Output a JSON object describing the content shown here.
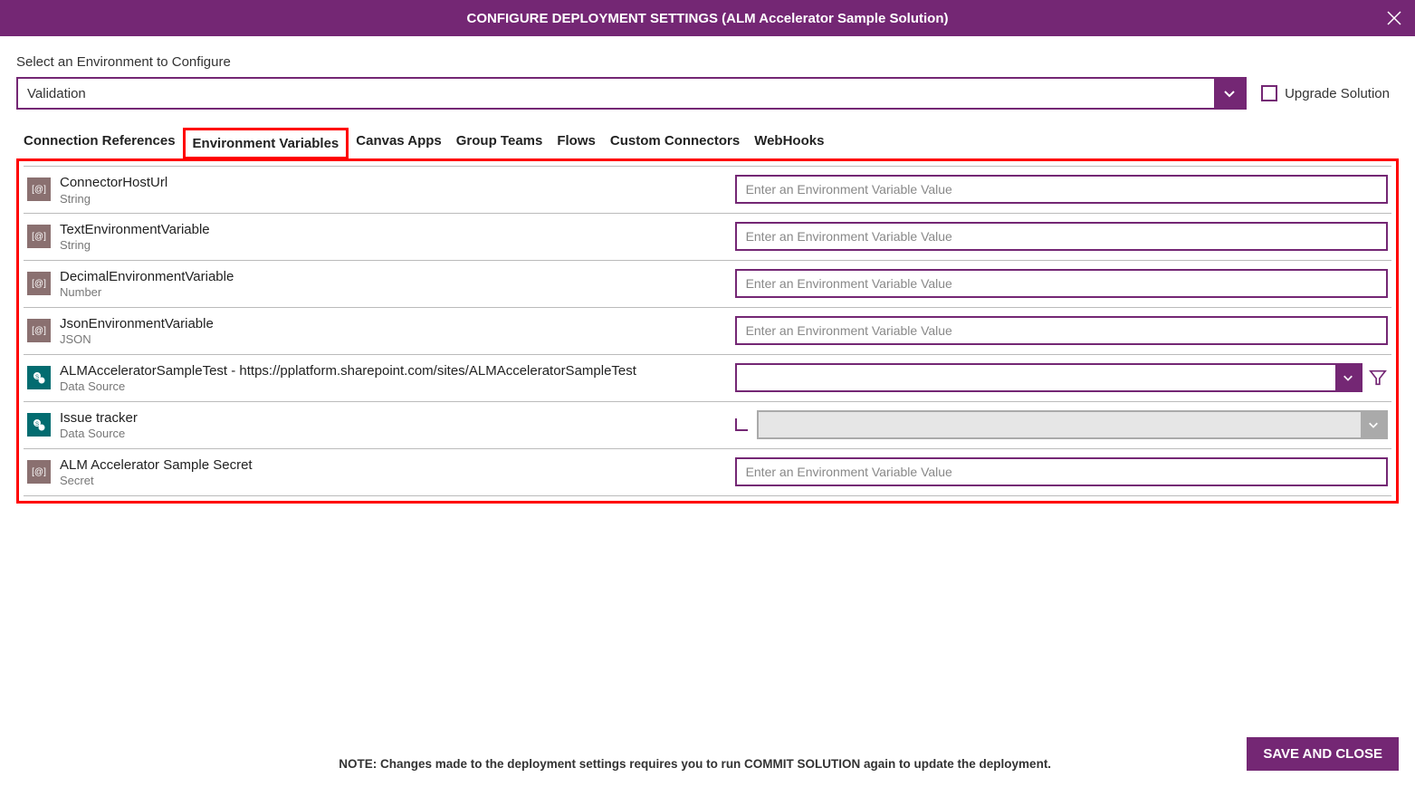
{
  "header": {
    "title": "CONFIGURE DEPLOYMENT SETTINGS (ALM Accelerator Sample Solution)"
  },
  "envSelect": {
    "label": "Select an Environment to Configure",
    "value": "Validation"
  },
  "upgradeCheckbox": {
    "label": "Upgrade Solution"
  },
  "tabs": [
    "Connection References",
    "Environment Variables",
    "Canvas Apps",
    "Group Teams",
    "Flows",
    "Custom Connectors",
    "WebHooks"
  ],
  "activeTabIndex": 1,
  "inputPlaceholder": "Enter an Environment Variable Value",
  "vars": [
    {
      "name": "ConnectorHostUrl",
      "type": "String",
      "icon": "generic",
      "control": "input"
    },
    {
      "name": "TextEnvironmentVariable",
      "type": "String",
      "icon": "generic",
      "control": "input"
    },
    {
      "name": "DecimalEnvironmentVariable",
      "type": "Number",
      "icon": "generic",
      "control": "input"
    },
    {
      "name": "JsonEnvironmentVariable",
      "type": "JSON",
      "icon": "generic",
      "control": "input"
    },
    {
      "name": "ALMAcceleratorSampleTest - https://pplatform.sharepoint.com/sites/ALMAcceleratorSampleTest",
      "type": "Data Source",
      "icon": "sharepoint",
      "control": "dropdown-filter"
    },
    {
      "name": "Issue tracker",
      "type": "Data Source",
      "icon": "sharepoint",
      "control": "dropdown-child"
    },
    {
      "name": "ALM Accelerator Sample Secret",
      "type": "Secret",
      "icon": "generic",
      "control": "input"
    }
  ],
  "footer": {
    "note": "NOTE: Changes made to the deployment settings requires you to run COMMIT SOLUTION again to update the deployment.",
    "saveLabel": "SAVE AND CLOSE"
  }
}
